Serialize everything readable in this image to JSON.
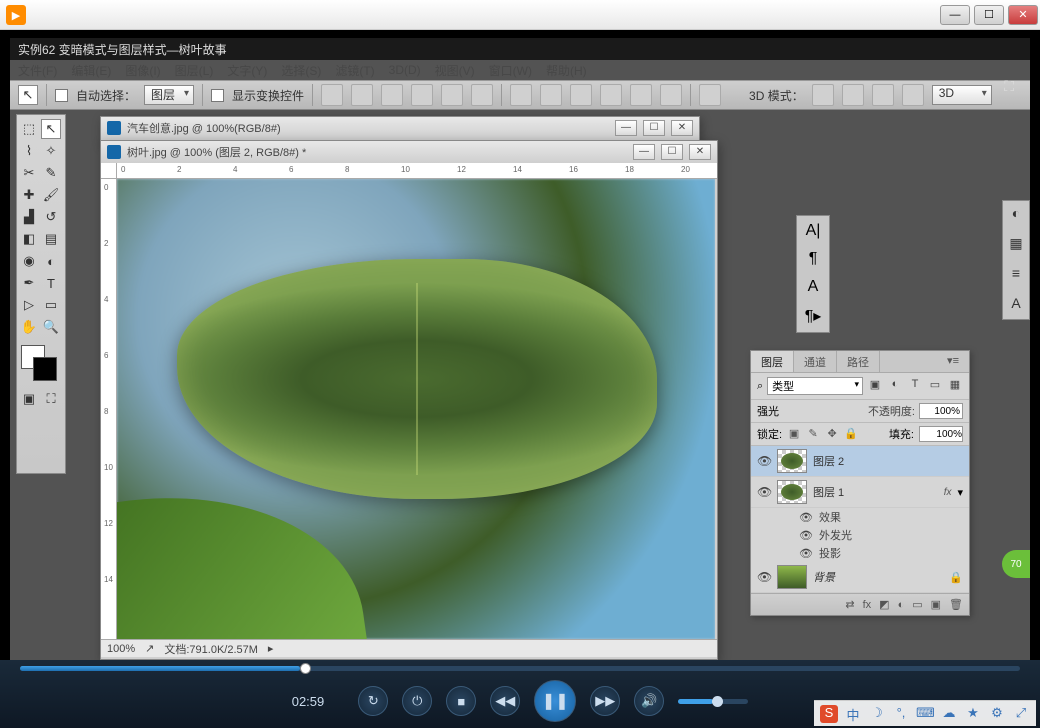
{
  "player": {
    "time": "02:59",
    "progress_pct": 28,
    "volume_pct": 50
  },
  "ps": {
    "title": "实例62 变暗模式与图层样式—树叶故事",
    "menus": [
      "文件(F)",
      "编辑(E)",
      "图像(I)",
      "图层(L)",
      "文字(Y)",
      "选择(S)",
      "滤镜(T)",
      "3D(D)",
      "视图(V)",
      "窗口(W)",
      "帮助(H)"
    ],
    "options": {
      "auto_select": "自动选择：",
      "target": "图层",
      "show_transform": "显示变换控件",
      "mode3d_lbl": "3D 模式：",
      "mode3d_val": "3D"
    },
    "doc_back": {
      "title": "汽车创意.jpg @ 100%(RGB/8#)"
    },
    "doc_front": {
      "title": "树叶.jpg @ 100% (图层 2, RGB/8#) *",
      "ruler_h": [
        "0",
        "2",
        "4",
        "6",
        "8",
        "10",
        "12",
        "14",
        "16",
        "18",
        "20"
      ],
      "ruler_v": [
        "0",
        "2",
        "4",
        "6",
        "8",
        "10",
        "12",
        "14"
      ],
      "zoom": "100%",
      "docinfo": "文档:791.0K/2.57M"
    },
    "layers_panel": {
      "tabs": [
        "图层",
        "通道",
        "路径"
      ],
      "filter": "类型",
      "blend": "强光",
      "opacity_lbl": "不透明度:",
      "opacity": "100%",
      "lock_lbl": "锁定:",
      "fill_lbl": "填充:",
      "fill": "100%",
      "filter_icons_title": "⌕",
      "layers": [
        {
          "name": "图层 2",
          "selected": true
        },
        {
          "name": "图层 1",
          "fx": "fx"
        },
        {
          "name": "背景",
          "locked": true
        }
      ],
      "effects": {
        "label": "效果",
        "items": [
          "外发光",
          "投影"
        ]
      }
    },
    "badge": "70"
  },
  "taskbar": {
    "ime": "中"
  }
}
